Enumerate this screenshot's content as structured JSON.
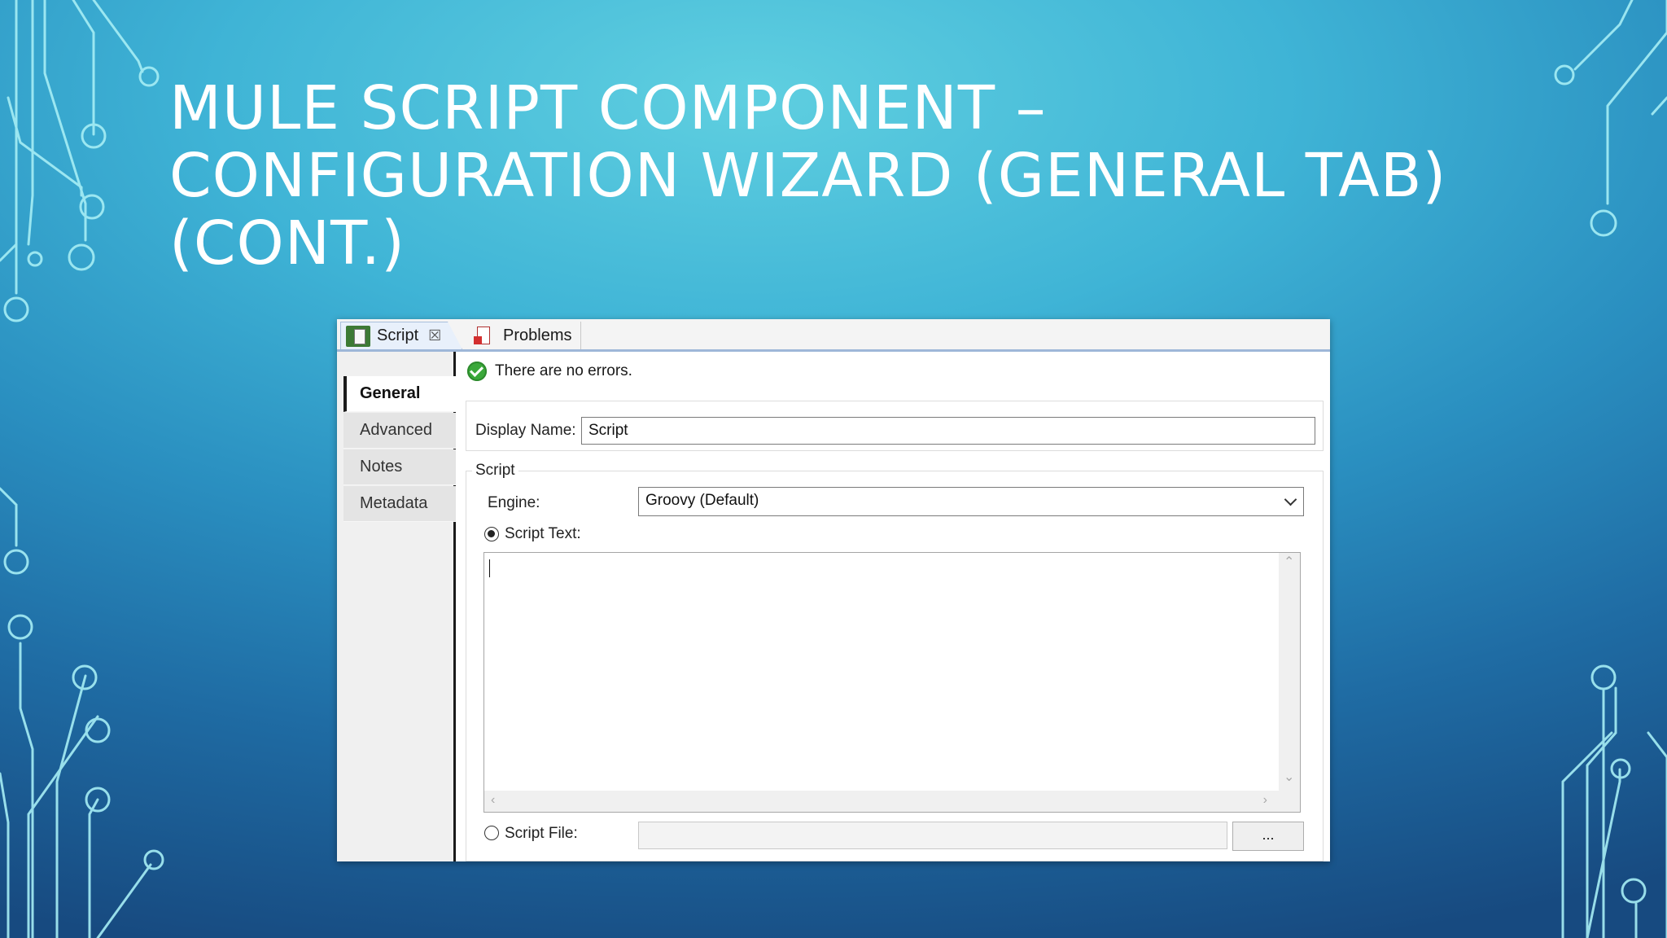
{
  "slide": {
    "title_lines": [
      "MULE SCRIPT COMPONENT –",
      "CONFIGURATION WIZARD (GENERAL TAB)",
      "(CONT.)"
    ]
  },
  "window": {
    "tabs": [
      {
        "label": "Script",
        "icon": "script-file-icon",
        "active": true,
        "closable": true
      },
      {
        "label": "Problems",
        "icon": "problems-icon",
        "active": false
      }
    ],
    "close_glyph": "☒",
    "nav": [
      {
        "label": "General",
        "selected": true
      },
      {
        "label": "Advanced"
      },
      {
        "label": "Notes"
      },
      {
        "label": "Metadata"
      }
    ],
    "status_text": "There are no errors.",
    "display_name": {
      "label": "Display Name:",
      "value": "Script"
    },
    "script_group": {
      "legend": "Script",
      "engine": {
        "label": "Engine:",
        "value": "Groovy (Default)"
      },
      "script_text": {
        "label": "Script Text:",
        "selected": true,
        "value": ""
      },
      "script_file": {
        "label": "Script File:",
        "selected": false,
        "value": ""
      },
      "browse_label": "..."
    }
  },
  "colors": {
    "tab_underline": "#9eb7d8",
    "success_green": "#3aa83a",
    "circuit_line": "#a6eef5"
  }
}
